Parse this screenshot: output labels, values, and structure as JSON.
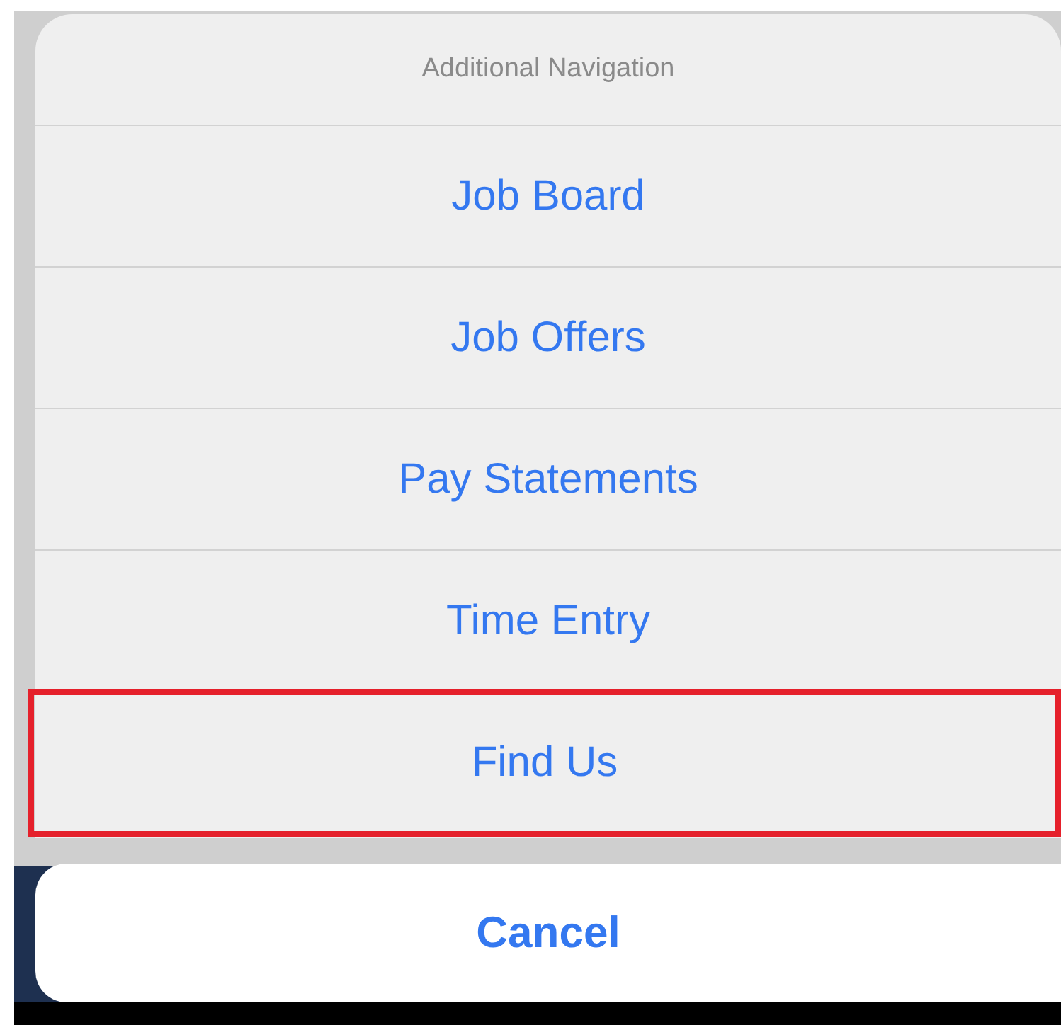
{
  "action_sheet": {
    "title": "Additional Navigation",
    "items": [
      {
        "label": "Job Board",
        "highlighted": false
      },
      {
        "label": "Job Offers",
        "highlighted": false
      },
      {
        "label": "Pay Statements",
        "highlighted": false
      },
      {
        "label": "Time Entry",
        "highlighted": false
      },
      {
        "label": "Find Us",
        "highlighted": true
      }
    ],
    "cancel": "Cancel"
  }
}
